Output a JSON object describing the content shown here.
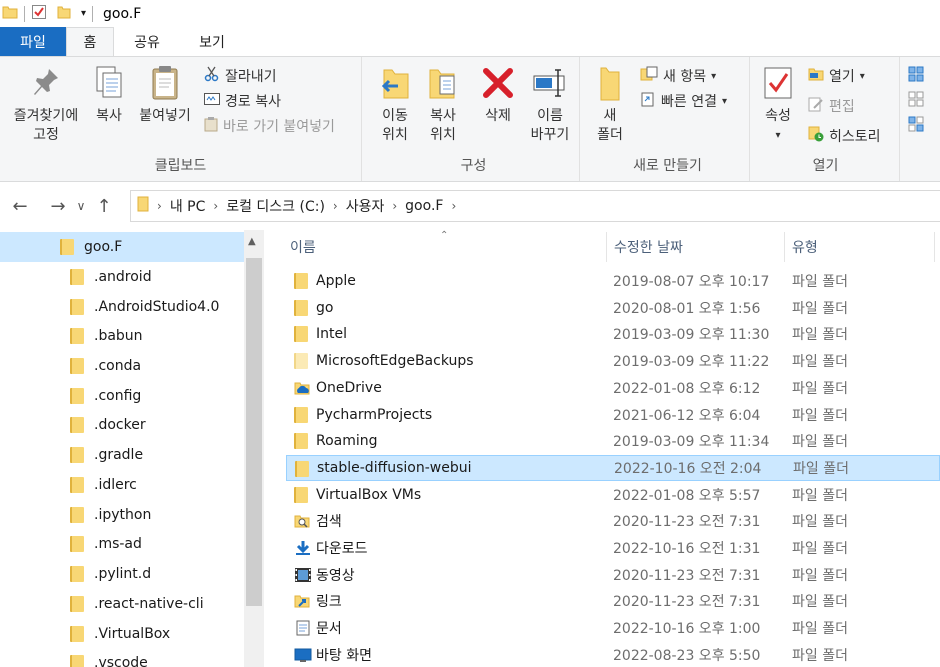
{
  "window": {
    "title": "goo.F"
  },
  "tabs": [
    {
      "label": "파일"
    },
    {
      "label": "홈"
    },
    {
      "label": "공유"
    },
    {
      "label": "보기"
    }
  ],
  "ribbon": {
    "clipboard": {
      "label": "클립보드",
      "pin_line1": "즐겨찾기에",
      "pin_line2": "고정",
      "copy": "복사",
      "paste": "붙여넣기",
      "cut": "잘라내기",
      "copy_path": "경로 복사",
      "paste_shortcut": "바로 가기 붙여넣기"
    },
    "organize": {
      "label": "구성",
      "move_line1": "이동",
      "move_line2": "위치",
      "copyto_line1": "복사",
      "copyto_line2": "위치",
      "delete": "삭제",
      "rename_line1": "이름",
      "rename_line2": "바꾸기"
    },
    "new": {
      "label": "새로 만들기",
      "folder_line1": "새",
      "folder_line2": "폴더",
      "new_item": "새 항목",
      "easy_access": "빠른 연결"
    },
    "open": {
      "label": "열기",
      "properties": "속성",
      "open": "열기",
      "edit": "편집",
      "history": "히스토리"
    }
  },
  "address": {
    "crumbs": [
      "내 PC",
      "로컬 디스크 (C:)",
      "사용자",
      "goo.F"
    ]
  },
  "nav_pane": {
    "items": [
      {
        "label": "goo.F",
        "selected": true
      },
      {
        "label": ".android"
      },
      {
        "label": ".AndroidStudio4.0"
      },
      {
        "label": ".babun"
      },
      {
        "label": ".conda"
      },
      {
        "label": ".config"
      },
      {
        "label": ".docker"
      },
      {
        "label": ".gradle"
      },
      {
        "label": ".idlerc"
      },
      {
        "label": ".ipython"
      },
      {
        "label": ".ms-ad"
      },
      {
        "label": ".pylint.d"
      },
      {
        "label": ".react-native-cli"
      },
      {
        "label": ".VirtualBox"
      },
      {
        "label": ".vscode"
      }
    ]
  },
  "file_list": {
    "columns": {
      "name": "이름",
      "date": "수정한 날짜",
      "type": "유형"
    },
    "rows": [
      {
        "name": "Apple",
        "date": "2019-08-07 오후 10:17",
        "type": "파일 폴더",
        "icon": "folder"
      },
      {
        "name": "go",
        "date": "2020-08-01 오후 1:56",
        "type": "파일 폴더",
        "icon": "folder"
      },
      {
        "name": "Intel",
        "date": "2019-03-09 오후 11:30",
        "type": "파일 폴더",
        "icon": "folder"
      },
      {
        "name": "MicrosoftEdgeBackups",
        "date": "2019-03-09 오후 11:22",
        "type": "파일 폴더",
        "icon": "folder-pale"
      },
      {
        "name": "OneDrive",
        "date": "2022-01-08 오후 6:12",
        "type": "파일 폴더",
        "icon": "onedrive"
      },
      {
        "name": "PycharmProjects",
        "date": "2021-06-12 오후 6:04",
        "type": "파일 폴더",
        "icon": "folder"
      },
      {
        "name": "Roaming",
        "date": "2019-03-09 오후 11:34",
        "type": "파일 폴더",
        "icon": "folder"
      },
      {
        "name": "stable-diffusion-webui",
        "date": "2022-10-16 오전 2:04",
        "type": "파일 폴더",
        "icon": "folder",
        "selected": true
      },
      {
        "name": "VirtualBox VMs",
        "date": "2022-01-08 오후 5:57",
        "type": "파일 폴더",
        "icon": "folder"
      },
      {
        "name": "검색",
        "date": "2020-11-23 오전 7:31",
        "type": "파일 폴더",
        "icon": "search-folder"
      },
      {
        "name": "다운로드",
        "date": "2022-10-16 오전 1:31",
        "type": "파일 폴더",
        "icon": "download"
      },
      {
        "name": "동영상",
        "date": "2020-11-23 오전 7:31",
        "type": "파일 폴더",
        "icon": "video"
      },
      {
        "name": "링크",
        "date": "2020-11-23 오전 7:31",
        "type": "파일 폴더",
        "icon": "link"
      },
      {
        "name": "문서",
        "date": "2022-10-16 오후 1:00",
        "type": "파일 폴더",
        "icon": "document"
      },
      {
        "name": "바탕 화면",
        "date": "2022-08-23 오후 5:50",
        "type": "파일 폴더",
        "icon": "desktop"
      }
    ]
  }
}
